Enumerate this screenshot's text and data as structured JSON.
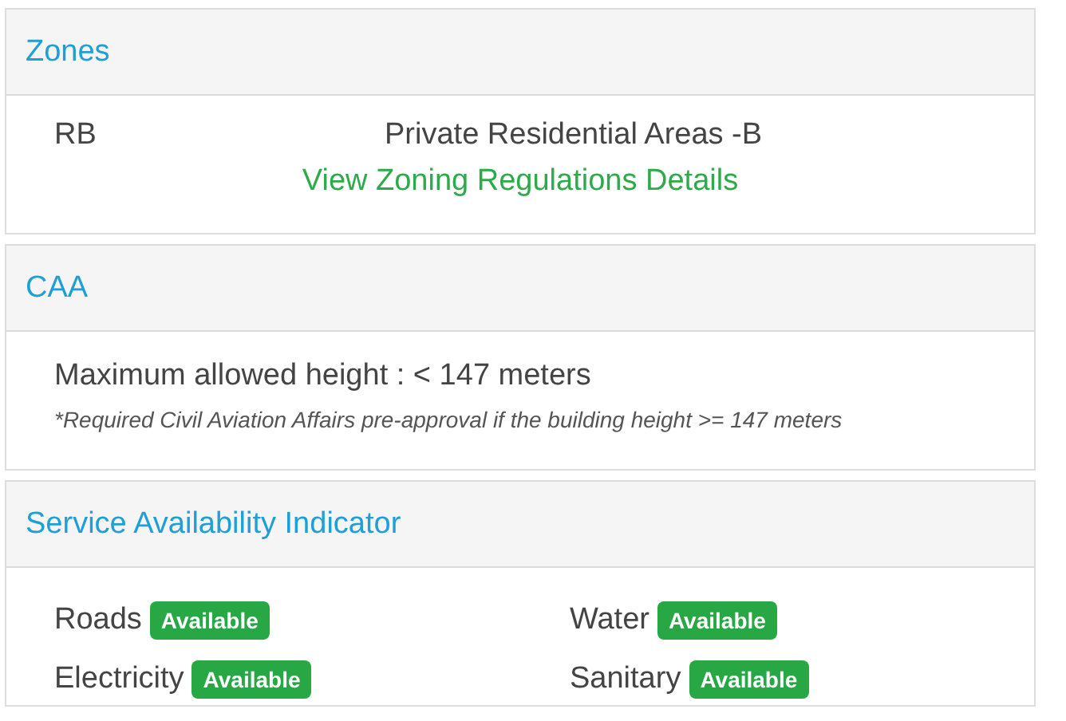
{
  "zones": {
    "title": "Zones",
    "code": "RB",
    "name": "Private Residential Areas -B",
    "link": "View Zoning Regulations Details"
  },
  "caa": {
    "title": "CAA",
    "max_height": "Maximum allowed height : < 147 meters",
    "note": "*Required Civil Aviation Affairs pre-approval if the building height >= 147 meters"
  },
  "services": {
    "title": "Service Availability Indicator",
    "items": [
      {
        "label": "Roads",
        "status": "Available"
      },
      {
        "label": "Water",
        "status": "Available"
      },
      {
        "label": "Electricity",
        "status": "Available"
      },
      {
        "label": "Sanitary",
        "status": "Available"
      }
    ]
  }
}
